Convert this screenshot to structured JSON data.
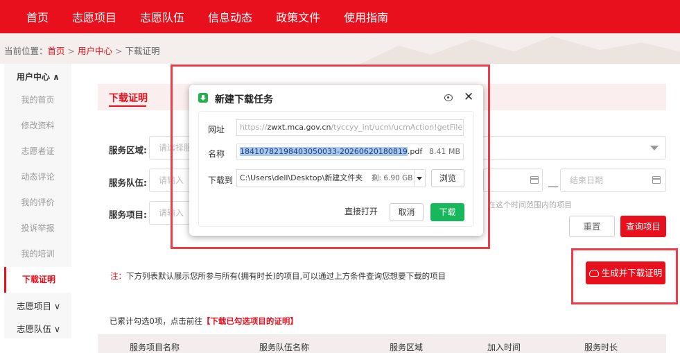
{
  "nav": {
    "items": [
      "首页",
      "志愿项目",
      "志愿队伍",
      "信息动态",
      "政策文件",
      "使用指南"
    ]
  },
  "breadcrumb": {
    "prefix": "当前位置：",
    "home": "首页",
    "sep1": ">",
    "user_center": "用户中心",
    "sep2": ">",
    "current": "下载证明"
  },
  "sidebar": {
    "header": "用户中心 ∧",
    "items": [
      "我的首页",
      "修改资料",
      "志愿者证",
      "动态评论",
      "我的评价",
      "投诉举报",
      "我的培训",
      "下载证明"
    ],
    "active_index": 7,
    "groups": [
      "志愿项目 ∨",
      "志愿队伍 ∨"
    ]
  },
  "main": {
    "tab": "下载证明",
    "form": {
      "area_label": "服务区域:",
      "area_placeholder": "请选择服",
      "team_label": "服务队伍:",
      "team_placeholder": "请输入",
      "project_label": "服务项目:",
      "project_placeholder": "请输入",
      "end_date_placeholder": "结束日期",
      "date_dash": "—",
      "hint": "在这个时间范围内的项目"
    },
    "buttons": {
      "reset": "重置",
      "query": "查询项目",
      "generate": "生成并下载证明"
    },
    "note_prefix": "注：",
    "note_text": "下方列表默认展示您所参与所有(拥有时长)的项目,可以通过上方条件查询您想要下载的项目",
    "count_text": "已累计勾选0项，点击前往",
    "count_link": "【下载已勾选项目的证明】",
    "table_headers": [
      "服务项目名称",
      "服务队伍名称",
      "服务区域",
      "加入时间",
      "服务时长"
    ]
  },
  "dialog": {
    "title": "新建下载任务",
    "url_label": "网址",
    "url_prefix": "https://",
    "url_host": "zwxt.mca.gov.cn",
    "url_rest": "/tyccyy_int/ucm/ucmAction!getFile.do?sysid=",
    "name_label": "名称",
    "file_name_selected": "18410782198403050033-20260620180819",
    "file_ext": ".pdf",
    "file_size": "8.41 MB",
    "path_label": "下载到",
    "path_value": "C:\\Users\\dell\\Desktop\\新建文件夹",
    "free_space": "剩: 6.90 GB",
    "browse": "浏览",
    "open_direct": "直接打开",
    "cancel": "取消",
    "download": "下载"
  },
  "colors": {
    "brand_red": "#e8101c",
    "download_green": "#16b85b",
    "annotation_red": "#f03c4a"
  }
}
